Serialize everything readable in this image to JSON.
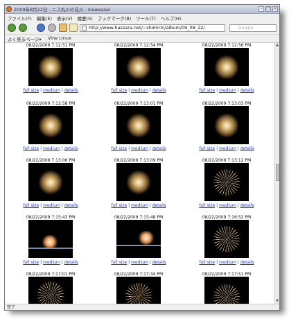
{
  "window": {
    "title": "2009年8月22日 - ニス丸川の花火 - Iceweasel"
  },
  "menu": [
    "ファイル(F)",
    "編集(E)",
    "表示(V)",
    "履歴(S)",
    "ブックマーク(B)",
    "ツール(T)",
    "ヘルプ(H)"
  ],
  "address": {
    "url": "http://www.haszara.net/~shimirin/album/09_08_22/"
  },
  "search": {
    "placeholder": "Google"
  },
  "bookmarks": {
    "item1": "よく見るページ▾",
    "item2": "Vine Linux"
  },
  "gallery": {
    "links": {
      "full": "full size",
      "medium": "medium",
      "details": "details",
      "sep": "|"
    },
    "items": [
      {
        "caption": "08/22/2009 7:12:51 PM"
      },
      {
        "caption": "08/22/2009 7:12:54 PM"
      },
      {
        "caption": "08/22/2009 7:12:56 PM"
      },
      {
        "caption": "08/22/2009 7:12:58 PM"
      },
      {
        "caption": "08/22/2009 7:13:01 PM"
      },
      {
        "caption": "08/22/2009 7:13:03 PM"
      },
      {
        "caption": "08/22/2009 7:13:06 PM"
      },
      {
        "caption": "08/22/2009 7:13:09 PM"
      },
      {
        "caption": "08/22/2009 7:13:12 PM"
      },
      {
        "caption": "08/22/2009 7:15:43 PM"
      },
      {
        "caption": "08/22/2009 7:15:48 PM"
      },
      {
        "caption": "08/22/2009 7:16:52 PM"
      },
      {
        "caption": "08/22/2009 7:17:01 PM"
      },
      {
        "caption": "08/22/2009 7:17:34 PM"
      },
      {
        "caption": "08/22/2009 7:17:51 PM"
      }
    ]
  },
  "status": {
    "text": "完了"
  }
}
